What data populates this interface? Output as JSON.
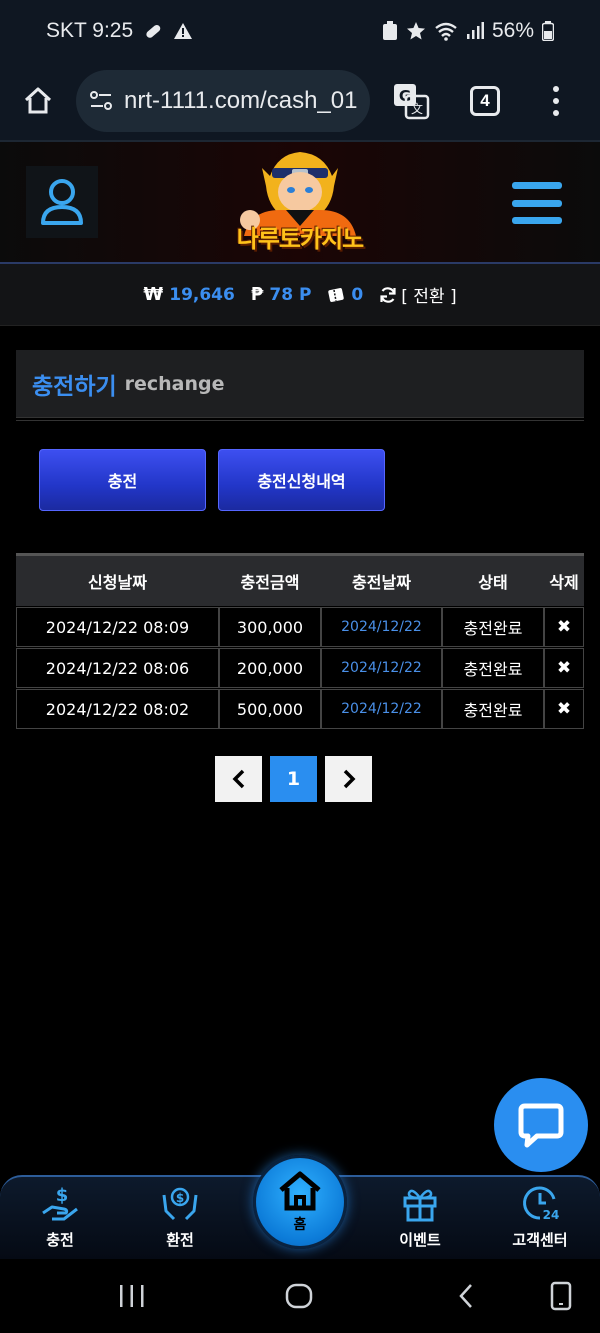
{
  "status_bar": {
    "carrier_time": "SKT 9:25",
    "battery": "56%"
  },
  "browser": {
    "url": "nrt-1111.com/cash_01",
    "tab_count": "4"
  },
  "header": {
    "logo_text": "나루토카지노"
  },
  "balance": {
    "won_symbol": "₩",
    "won_value": "19,646",
    "point_symbol": "₱",
    "point_value": "78 P",
    "chip_value": "0",
    "convert_label": "[ 전환 ]"
  },
  "section": {
    "title_ko": "충전하기",
    "title_en": "rechange"
  },
  "buttons": {
    "charge": "충전",
    "history": "충전신청내역"
  },
  "table": {
    "headers": [
      "신청날짜",
      "충전금액",
      "충전날짜",
      "상태",
      "삭제"
    ],
    "rows": [
      {
        "request_date": "2024/12/22 08:09",
        "amount": "300,000",
        "charge_date": "2024/12/22",
        "status": "충전완료",
        "delete": "✖"
      },
      {
        "request_date": "2024/12/22 08:06",
        "amount": "200,000",
        "charge_date": "2024/12/22",
        "status": "충전완료",
        "delete": "✖"
      },
      {
        "request_date": "2024/12/22 08:02",
        "amount": "500,000",
        "charge_date": "2024/12/22",
        "status": "충전완료",
        "delete": "✖"
      }
    ]
  },
  "pagination": {
    "prev": "‹",
    "current": "1",
    "next": "›"
  },
  "bottom_nav": {
    "charge": "충전",
    "exchange": "환전",
    "home": "홈",
    "event": "이벤트",
    "support": "고객센터"
  },
  "colors": {
    "accent_blue": "#2a8ef0",
    "value_blue": "#3b8ef0",
    "logo_gold": "#ffc21a"
  }
}
